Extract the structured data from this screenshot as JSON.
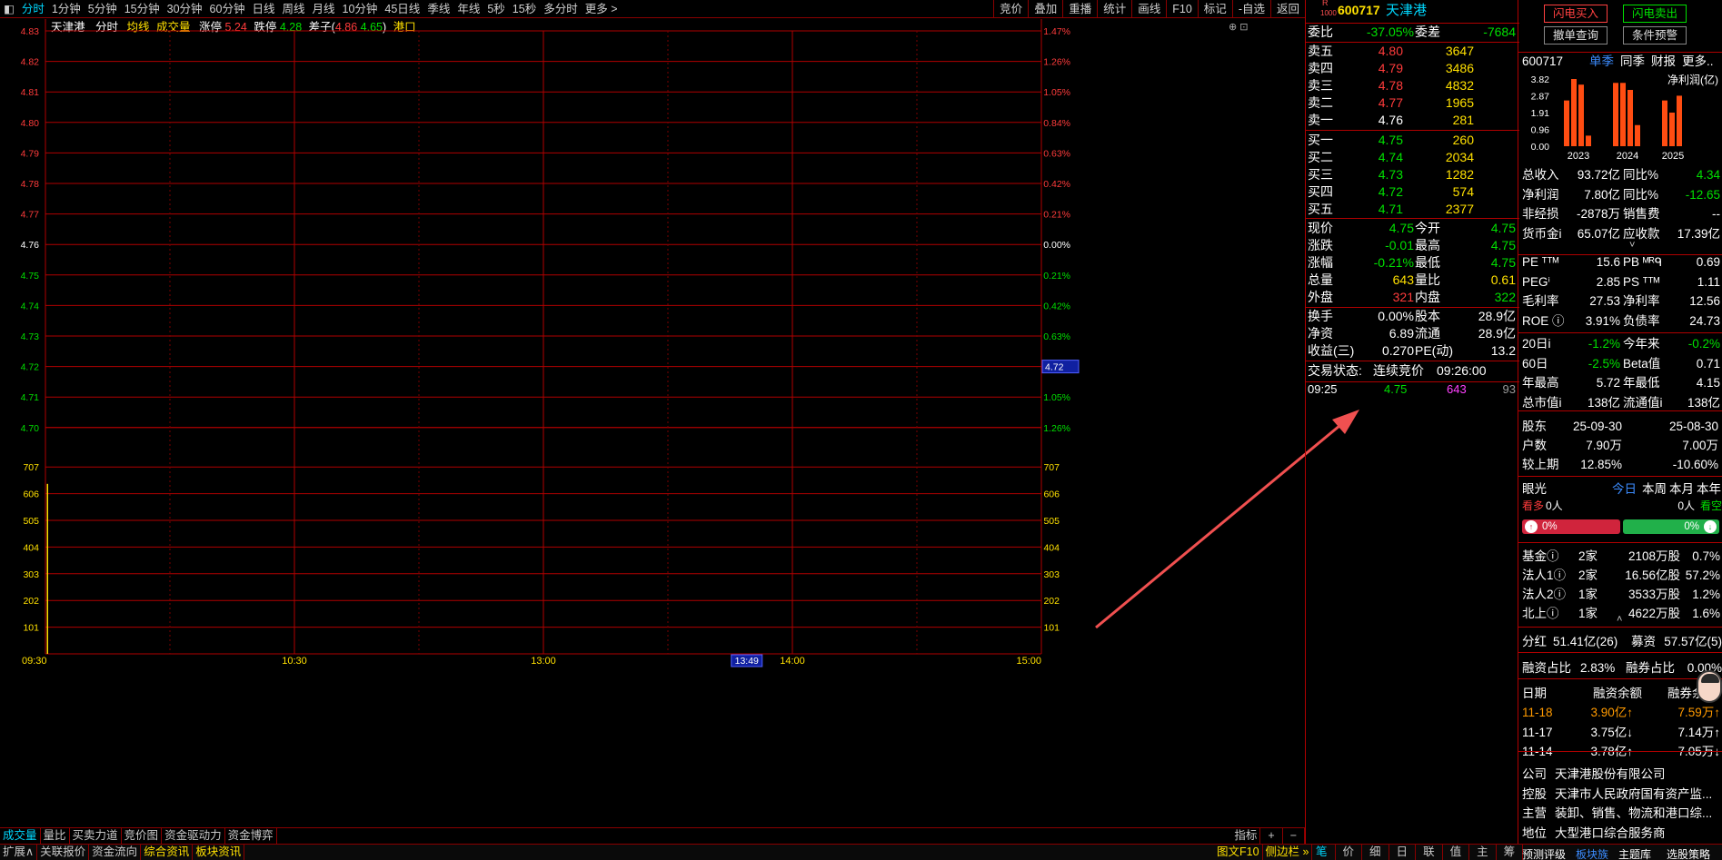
{
  "colors": {
    "up": "#ff3b3b",
    "down": "#00e000",
    "flat": "#ffffff",
    "grid": "#b00000",
    "accent": "#00d8ff",
    "volume": "#ffe000"
  },
  "toolbar": {
    "left_icon": "◧",
    "periods": [
      "分时",
      "1分钟",
      "5分钟",
      "15分钟",
      "30分钟",
      "60分钟",
      "日线",
      "周线",
      "月线",
      "10分钟",
      "45日线",
      "季线",
      "年线",
      "5秒",
      "15秒",
      "多分时",
      "更多 >"
    ],
    "tools": [
      "竞价",
      "叠加",
      "重播",
      "统计",
      "画线",
      "F10",
      "标记",
      "-自选",
      "返回"
    ]
  },
  "chart_header": {
    "name": "天津港",
    "mode": "分时",
    "avg_label": "均线",
    "vol_label": "成交量",
    "limit_up_label": "涨停",
    "limit_up": "5.24",
    "limit_down_label": "跌停",
    "limit_down": "4.28",
    "range_label": "差子(",
    "range_hi": "4.86",
    "range_lo": "4.65",
    "range_close": ")",
    "sector": "港口"
  },
  "chart_data": {
    "type": "line",
    "title": "",
    "price_axis": {
      "ticks": [
        "4.83",
        "4.82",
        "4.81",
        "4.80",
        "4.79",
        "4.78",
        "4.77",
        "4.76",
        "4.75",
        "4.74",
        "4.73",
        "4.72",
        "4.71",
        "4.70"
      ],
      "pct_ticks": [
        "1.47%",
        "1.26%",
        "1.05%",
        "0.84%",
        "0.63%",
        "0.42%",
        "0.21%",
        "0.00%",
        "0.21%",
        "0.42%",
        "0.63%",
        "0.84%",
        "1.05%",
        "1.26%"
      ],
      "prev_close": 4.76,
      "ylim": [
        4.7,
        4.83
      ]
    },
    "volume_axis": {
      "ticks": [
        "707",
        "606",
        "505",
        "404",
        "303",
        "202",
        "101"
      ],
      "ylim": [
        0,
        808
      ]
    },
    "x_ticks": [
      "09:30",
      "10:30",
      "13:00",
      "14:00",
      "15:00"
    ],
    "series": [
      {
        "values": [
          643
        ],
        "x": [
          "09:30"
        ]
      }
    ],
    "cursor_price": "4.72",
    "cursor_time": "13:49"
  },
  "bottom1": [
    "成交量",
    "量比",
    "买卖力道",
    "竞价图",
    "资金驱动力",
    "资金博弈"
  ],
  "bottom1_right": [
    "指标",
    "+",
    "−"
  ],
  "bottom2": [
    "扩展∧",
    "关联报价",
    "资金流向",
    "综合资讯",
    "板块资讯"
  ],
  "bottom2_right": [
    "图文F10",
    "侧边栏 »",
    "笔",
    "价",
    "细",
    "日",
    "联",
    "值",
    "主",
    "筹"
  ],
  "quote": {
    "badge_r": "R",
    "badge_num": "1000",
    "code": "600717",
    "name": "天津港",
    "webi_label": "委比",
    "webi": "-37.05%",
    "weicha_label": "委差",
    "weicha": "-7684",
    "asks": [
      {
        "label": "卖五",
        "price": "4.80",
        "vol": "3647"
      },
      {
        "label": "卖四",
        "price": "4.79",
        "vol": "3486"
      },
      {
        "label": "卖三",
        "price": "4.78",
        "vol": "4832"
      },
      {
        "label": "卖二",
        "price": "4.77",
        "vol": "1965"
      },
      {
        "label": "卖一",
        "price": "4.76",
        "vol": "281"
      }
    ],
    "bids": [
      {
        "label": "买一",
        "price": "4.75",
        "vol": "260"
      },
      {
        "label": "买二",
        "price": "4.74",
        "vol": "2034"
      },
      {
        "label": "买三",
        "price": "4.73",
        "vol": "1282"
      },
      {
        "label": "买四",
        "price": "4.72",
        "vol": "574"
      },
      {
        "label": "买五",
        "price": "4.71",
        "vol": "2377"
      }
    ],
    "stats": [
      {
        "l1": "现价",
        "v1": "4.75",
        "l2": "今开",
        "v2": "4.75"
      },
      {
        "l1": "涨跌",
        "v1": "-0.01",
        "l2": "最高",
        "v2": "4.75"
      },
      {
        "l1": "涨幅",
        "v1": "-0.21%",
        "l2": "最低",
        "v2": "4.75"
      },
      {
        "l1": "总量",
        "v1": "643",
        "l2": "量比",
        "v2": "0.61"
      },
      {
        "l1": "外盘",
        "v1": "321",
        "l2": "内盘",
        "v2": "322"
      }
    ],
    "stats2": [
      {
        "l1": "换手",
        "v1": "0.00%",
        "l2": "股本",
        "v2": "28.9亿"
      },
      {
        "l1": "净资",
        "v1": "6.89",
        "l2": "流通",
        "v2": "28.9亿"
      },
      {
        "l1": "收益(三)",
        "v1": "0.270",
        "l2": "PE(动)",
        "v2": "13.2"
      }
    ],
    "status_label": "交易状态:",
    "status": "连续竞价",
    "status_time": "09:26:00",
    "ticks": [
      {
        "time": "09:25",
        "price": "4.75",
        "vol": "643",
        "n": "93"
      }
    ]
  },
  "fund": {
    "btn_buy": "闪电买入",
    "btn_sell": "闪电卖出",
    "btn_cancel": "撤单查询",
    "btn_alert": "条件预警",
    "code": "600717",
    "tab_active": "单季",
    "tabs": [
      "同季",
      "财报",
      "更多.."
    ],
    "profit_label": "净利润(亿)",
    "bar_chart": {
      "y_ticks": [
        "3.82",
        "2.87",
        "1.91",
        "0.96",
        "0.00"
      ],
      "years": [
        "2023",
        "2024",
        "2025"
      ],
      "values": [
        [
          2.6,
          3.82,
          3.5,
          0.6
        ],
        [
          3.6,
          3.6,
          3.2,
          1.2
        ],
        [
          2.6,
          1.91,
          2.87
        ]
      ],
      "ylim": [
        0,
        3.82
      ]
    },
    "rows": [
      {
        "l1": "总收入",
        "v1": "93.72亿",
        "l2": "同比%",
        "v2": "4.34",
        "c2": "grn"
      },
      {
        "l1": "净利润",
        "v1": "7.80亿",
        "l2": "同比%",
        "v2": "-12.65",
        "c2": "grn"
      },
      {
        "l1": "非经损",
        "v1": "-2878万",
        "l2": "销售费",
        "v2": "--",
        "c2": "wht"
      },
      {
        "l1": "货币金i",
        "v1": "65.07亿",
        "l2": "应收款",
        "v2": "17.39亿",
        "c2": "wht"
      }
    ],
    "val_rows": [
      {
        "l1": "PE ᵀᵀᴹ",
        "v1": "15.6",
        "l2": "PB ᴹᴿᑫ",
        "v2": "0.69"
      },
      {
        "l1": "PEGⁱ",
        "v1": "2.85",
        "l2": "PS ᵀᵀᴹ",
        "v2": "1.11"
      },
      {
        "l1": "毛利率",
        "v1": "27.53",
        "l2": "净利率",
        "v2": "12.56"
      },
      {
        "l1": "ROE ⓘ",
        "v1": "3.91%",
        "l2": "负债率",
        "v2": "24.73"
      }
    ],
    "perf_rows": [
      {
        "l1": "20日i",
        "v1": "-1.2%",
        "c1": "grn",
        "l2": "今年来",
        "v2": "-0.2%",
        "c2": "grn"
      },
      {
        "l1": "60日",
        "v1": "-2.5%",
        "c1": "grn",
        "l2": "Beta值",
        "v2": "0.71",
        "c2": "wht"
      },
      {
        "l1": "年最高",
        "v1": "5.72",
        "c1": "wht",
        "l2": "年最低",
        "v2": "4.15",
        "c2": "wht"
      },
      {
        "l1": "总市值i",
        "v1": "138亿",
        "c1": "wht",
        "l2": "流通值i",
        "v2": "138亿",
        "c2": "wht"
      }
    ],
    "holders": {
      "title": "股东",
      "d1": "25-09-30",
      "d2": "25-08-30",
      "hu_label": "户数",
      "hu1": "7.90万",
      "hu2": "7.00万",
      "cmp_label": "较上期",
      "cmp1": "12.85%",
      "cmp2": "-10.60%"
    },
    "eye": {
      "label": "眼光",
      "tabs": [
        "今日",
        "本周",
        "本月",
        "本年"
      ],
      "bull": "看多",
      "bull_n": "0人",
      "bear": "看空",
      "bear_n": "0人",
      "bull_pct": "0%",
      "bear_pct": "0%"
    },
    "inst": [
      {
        "l": "基金ⓘ",
        "n": "2家",
        "v": "2108万股",
        "p": "0.7%"
      },
      {
        "l": "法人1ⓘ",
        "n": "2家",
        "v": "16.56亿股",
        "p": "57.2%"
      },
      {
        "l": "法人2ⓘ",
        "n": "1家",
        "v": "3533万股",
        "p": "1.2%"
      },
      {
        "l": "北上ⓘ",
        "n": "1家",
        "v": "4622万股",
        "p": "1.6%"
      }
    ],
    "div": {
      "l1": "分红",
      "v1": "51.41亿(26)",
      "l2": "募资",
      "v2": "57.57亿(5)"
    },
    "margin_ratio": {
      "l1": "融资占比",
      "v1": "2.83%",
      "l2": "融券占比",
      "v2": "0.00%"
    },
    "margin_hdr": {
      "c1": "日期",
      "c2": "融资余额",
      "c3": "融券余"
    },
    "margin_rows": [
      {
        "d": "11-18",
        "a": "3.90亿↑",
        "b": "7.59万↑"
      },
      {
        "d": "11-17",
        "a": "3.75亿↓",
        "b": "7.14万↑"
      },
      {
        "d": "11-14",
        "a": "3.78亿↑",
        "b": "7.05万↓"
      }
    ],
    "company": [
      {
        "l": "公司",
        "v": "天津港股份有限公司"
      },
      {
        "l": "控股",
        "v": "天津市人民政府国有资产监..."
      },
      {
        "l": "主营",
        "v": "装卸、销售、物流和港口综..."
      },
      {
        "l": "地位",
        "v": "大型港口综合服务商"
      }
    ],
    "bottom_links": [
      "预测评级",
      "板块族",
      "主题库",
      "选股策略"
    ]
  }
}
